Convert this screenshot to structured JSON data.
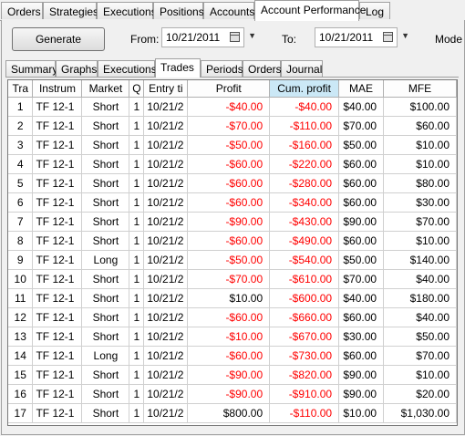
{
  "top_tabs": [
    {
      "label": "Orders",
      "active": false
    },
    {
      "label": "Strategies",
      "active": false
    },
    {
      "label": "Executions",
      "active": false
    },
    {
      "label": "Positions",
      "active": false
    },
    {
      "label": "Accounts",
      "active": false
    },
    {
      "label": "Account Performance",
      "active": true
    },
    {
      "label": "Log",
      "active": false
    }
  ],
  "controls": {
    "generate_label": "Generate",
    "from_label": "From:",
    "from_value": "10/21/2011",
    "to_label": "To:",
    "to_value": "10/21/2011",
    "mode_label": "Mode"
  },
  "sub_tabs": [
    {
      "label": "Summary",
      "active": false
    },
    {
      "label": "Graphs",
      "active": false
    },
    {
      "label": "Executions",
      "active": false
    },
    {
      "label": "Trades",
      "active": true
    },
    {
      "label": "Periods",
      "active": false
    },
    {
      "label": "Orders",
      "active": false
    },
    {
      "label": "Journal",
      "active": false
    }
  ],
  "columns": [
    "Tra",
    "Instrum",
    "Market",
    "Q",
    "Entry ti",
    "Profit",
    "Cum. profit",
    "MAE",
    "MFE"
  ],
  "selected_column": "Cum. profit",
  "colors": {
    "negative": "#ff0000",
    "positive": "#000000",
    "selected_header": "#cbe8f6"
  },
  "rows": [
    [
      "1",
      "TF 12-1",
      "Short",
      "1",
      "10/21/2",
      "-$40.00",
      "-$40.00",
      "$40.00",
      "$100.00"
    ],
    [
      "2",
      "TF 12-1",
      "Short",
      "1",
      "10/21/2",
      "-$70.00",
      "-$110.00",
      "$70.00",
      "$60.00"
    ],
    [
      "3",
      "TF 12-1",
      "Short",
      "1",
      "10/21/2",
      "-$50.00",
      "-$160.00",
      "$50.00",
      "$10.00"
    ],
    [
      "4",
      "TF 12-1",
      "Short",
      "1",
      "10/21/2",
      "-$60.00",
      "-$220.00",
      "$60.00",
      "$10.00"
    ],
    [
      "5",
      "TF 12-1",
      "Short",
      "1",
      "10/21/2",
      "-$60.00",
      "-$280.00",
      "$60.00",
      "$80.00"
    ],
    [
      "6",
      "TF 12-1",
      "Short",
      "1",
      "10/21/2",
      "-$60.00",
      "-$340.00",
      "$60.00",
      "$30.00"
    ],
    [
      "7",
      "TF 12-1",
      "Short",
      "1",
      "10/21/2",
      "-$90.00",
      "-$430.00",
      "$90.00",
      "$70.00"
    ],
    [
      "8",
      "TF 12-1",
      "Short",
      "1",
      "10/21/2",
      "-$60.00",
      "-$490.00",
      "$60.00",
      "$10.00"
    ],
    [
      "9",
      "TF 12-1",
      "Long",
      "1",
      "10/21/2",
      "-$50.00",
      "-$540.00",
      "$50.00",
      "$140.00"
    ],
    [
      "10",
      "TF 12-1",
      "Short",
      "1",
      "10/21/2",
      "-$70.00",
      "-$610.00",
      "$70.00",
      "$40.00"
    ],
    [
      "11",
      "TF 12-1",
      "Short",
      "1",
      "10/21/2",
      "$10.00",
      "-$600.00",
      "$40.00",
      "$180.00"
    ],
    [
      "12",
      "TF 12-1",
      "Short",
      "1",
      "10/21/2",
      "-$60.00",
      "-$660.00",
      "$60.00",
      "$40.00"
    ],
    [
      "13",
      "TF 12-1",
      "Short",
      "1",
      "10/21/2",
      "-$10.00",
      "-$670.00",
      "$30.00",
      "$50.00"
    ],
    [
      "14",
      "TF 12-1",
      "Long",
      "1",
      "10/21/2",
      "-$60.00",
      "-$730.00",
      "$60.00",
      "$70.00"
    ],
    [
      "15",
      "TF 12-1",
      "Short",
      "1",
      "10/21/2",
      "-$90.00",
      "-$820.00",
      "$90.00",
      "$10.00"
    ],
    [
      "16",
      "TF 12-1",
      "Short",
      "1",
      "10/21/2",
      "-$90.00",
      "-$910.00",
      "$90.00",
      "$20.00"
    ],
    [
      "17",
      "TF 12-1",
      "Short",
      "1",
      "10/21/2",
      "$800.00",
      "-$110.00",
      "$10.00",
      "$1,030.00"
    ]
  ]
}
